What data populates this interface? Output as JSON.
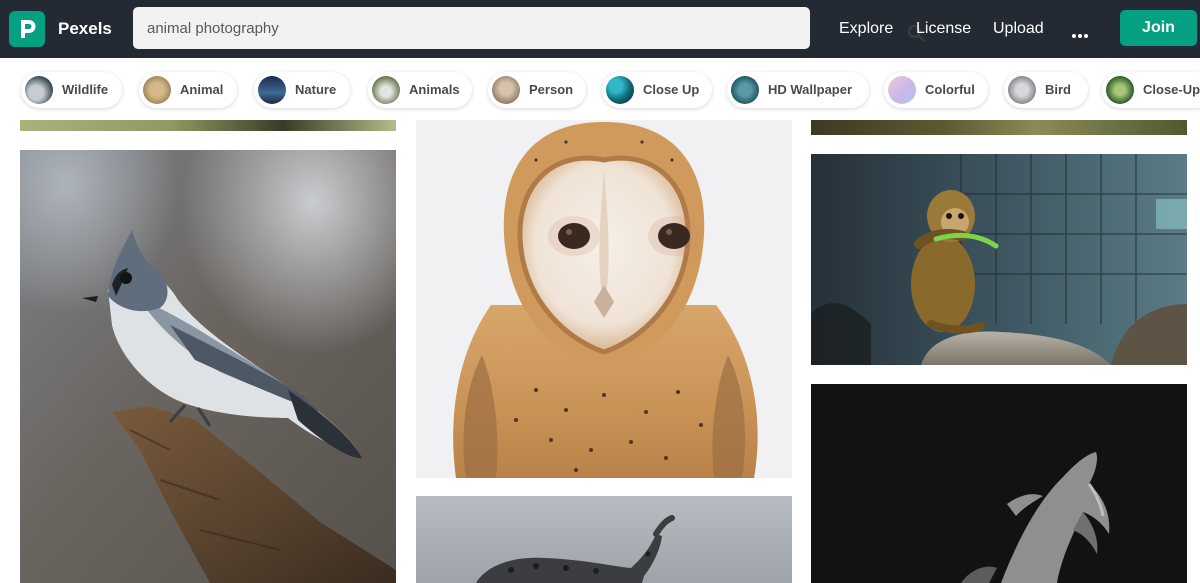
{
  "header": {
    "brand": "Pexels",
    "search": {
      "value": "animal photography"
    },
    "nav": [
      {
        "label": "Explore"
      },
      {
        "label": "License"
      },
      {
        "label": "Upload"
      }
    ],
    "more_icon": "ellipsis-icon",
    "join_label": "Join"
  },
  "tags": [
    {
      "label": "Wildlife",
      "thumb": "#3c4a55"
    },
    {
      "label": "Animal",
      "thumb": "#9b8257"
    },
    {
      "label": "Nature",
      "thumb": "#2d4a6e"
    },
    {
      "label": "Animals",
      "thumb": "#6b7a52"
    },
    {
      "label": "Person",
      "thumb": "#8a7866"
    },
    {
      "label": "Close Up",
      "thumb": "#0e6a78"
    },
    {
      "label": "HD Wallpaper",
      "thumb": "#245862"
    },
    {
      "label": "Colorful",
      "thumb": "#c8b8e8"
    },
    {
      "label": "Bird",
      "thumb": "#7e8088"
    },
    {
      "label": "Close-Up",
      "thumb": "#2f5a2a"
    }
  ],
  "colors": {
    "topbar": "#232a34",
    "accent": "#05a081"
  }
}
